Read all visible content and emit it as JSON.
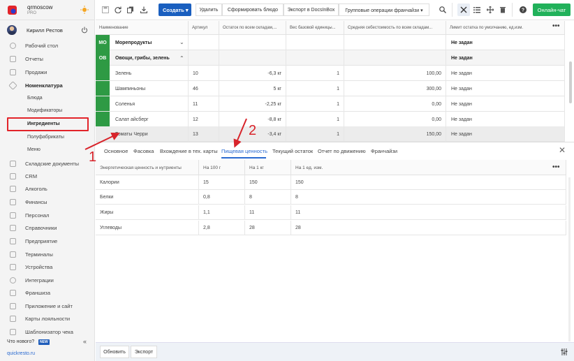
{
  "brand": {
    "name": "qrmoscow",
    "plan": "PRO"
  },
  "user": {
    "name": "Кирилл Рестов"
  },
  "sidebar": {
    "items": [
      {
        "label": "Рабочий стол"
      },
      {
        "label": "Отчеты"
      },
      {
        "label": "Продажи"
      },
      {
        "label": "Номенклатура"
      }
    ],
    "sub_items": [
      {
        "label": "Блюда"
      },
      {
        "label": "Модификаторы"
      },
      {
        "label": "Ингредиенты"
      },
      {
        "label": "Полуфабрикаты"
      },
      {
        "label": "Меню"
      }
    ],
    "items2": [
      {
        "label": "Складские документы"
      },
      {
        "label": "CRM"
      },
      {
        "label": "Алкоголь"
      },
      {
        "label": "Финансы"
      },
      {
        "label": "Персонал"
      },
      {
        "label": "Справочники"
      },
      {
        "label": "Предприятие"
      },
      {
        "label": "Терминалы"
      },
      {
        "label": "Устройства"
      },
      {
        "label": "Интеграции"
      },
      {
        "label": "Франшиза"
      },
      {
        "label": "Приложение и сайт"
      },
      {
        "label": "Карты лояльности"
      },
      {
        "label": "Шаблонизатор чека"
      }
    ],
    "whats_new": "Что нового?",
    "new_badge": "NEW",
    "collapse": "«",
    "site": "quickresto.ru"
  },
  "toolbar": {
    "create": "Создать ▾",
    "delete": "Удалить",
    "form_dish": "Сформировать блюдо",
    "export_docs": "Экспорт в DocsInBox",
    "group_ops": "Групповые операции франчайзи ▾",
    "online_chat": "Онлайн-чат",
    "accent": "#1a5fbf",
    "chat_color": "#21b15a"
  },
  "table": {
    "headers": [
      "Наименование",
      "Артикул",
      "Остаток по всем складам,...",
      "Вес базовой единицы...",
      "Средняя себестоимость по всем складам...",
      "Лимит остатка по умолчанию, ед.изм."
    ],
    "groups": [
      {
        "badge": "МО",
        "name": "Морепродукты",
        "chevron": "⌄",
        "limit": "Не задан"
      },
      {
        "badge": "ОВ",
        "name": "Овощи, грибы, зелень",
        "chevron": "⌃",
        "limit": "Не задан"
      }
    ],
    "rows": [
      {
        "name": "Зелень",
        "article": "10",
        "stock": "-6,3 кг",
        "weight": "1",
        "cost": "100,00",
        "limit": "Не задан"
      },
      {
        "name": "Шампиньоны",
        "article": "46",
        "stock": "5 кг",
        "weight": "1",
        "cost": "300,00",
        "limit": "Не задан"
      },
      {
        "name": "Соленья",
        "article": "11",
        "stock": "-2,25 кг",
        "weight": "1",
        "cost": "0,00",
        "limit": "Не задан"
      },
      {
        "name": "Салат айсберг",
        "article": "12",
        "stock": "-8,8 кг",
        "weight": "1",
        "cost": "0,00",
        "limit": "Не задан"
      },
      {
        "name": "Томаты Черри",
        "article": "13",
        "stock": "-3,4 кг",
        "weight": "1",
        "cost": "150,00",
        "limit": "Не задан"
      }
    ]
  },
  "detail": {
    "tabs": [
      "Основное",
      "Фасовка",
      "Вхождение в тех. карты",
      "Пищевая ценность",
      "Текущий остаток",
      "Отчет по движению",
      "Франчайзи"
    ],
    "active_tab": "Пищевая ценность",
    "headers": [
      "Энергетическая ценность и нутриенты",
      "На 100 г",
      "На 1 кг",
      "На 1 ед. изм."
    ],
    "rows": [
      {
        "name": "Калории",
        "per100": "15",
        "perkg": "150",
        "perunit": "150"
      },
      {
        "name": "Белки",
        "per100": "0,8",
        "perkg": "8",
        "perunit": "8"
      },
      {
        "name": "Жиры",
        "per100": "1,1",
        "perkg": "11",
        "perunit": "11"
      },
      {
        "name": "Углеводы",
        "per100": "2,8",
        "perkg": "28",
        "perunit": "28"
      }
    ]
  },
  "bottom": {
    "refresh": "Обновить",
    "export": "Экспорт"
  },
  "annotations": {
    "one": "1",
    "two": "2",
    "color": "#d8232a"
  }
}
